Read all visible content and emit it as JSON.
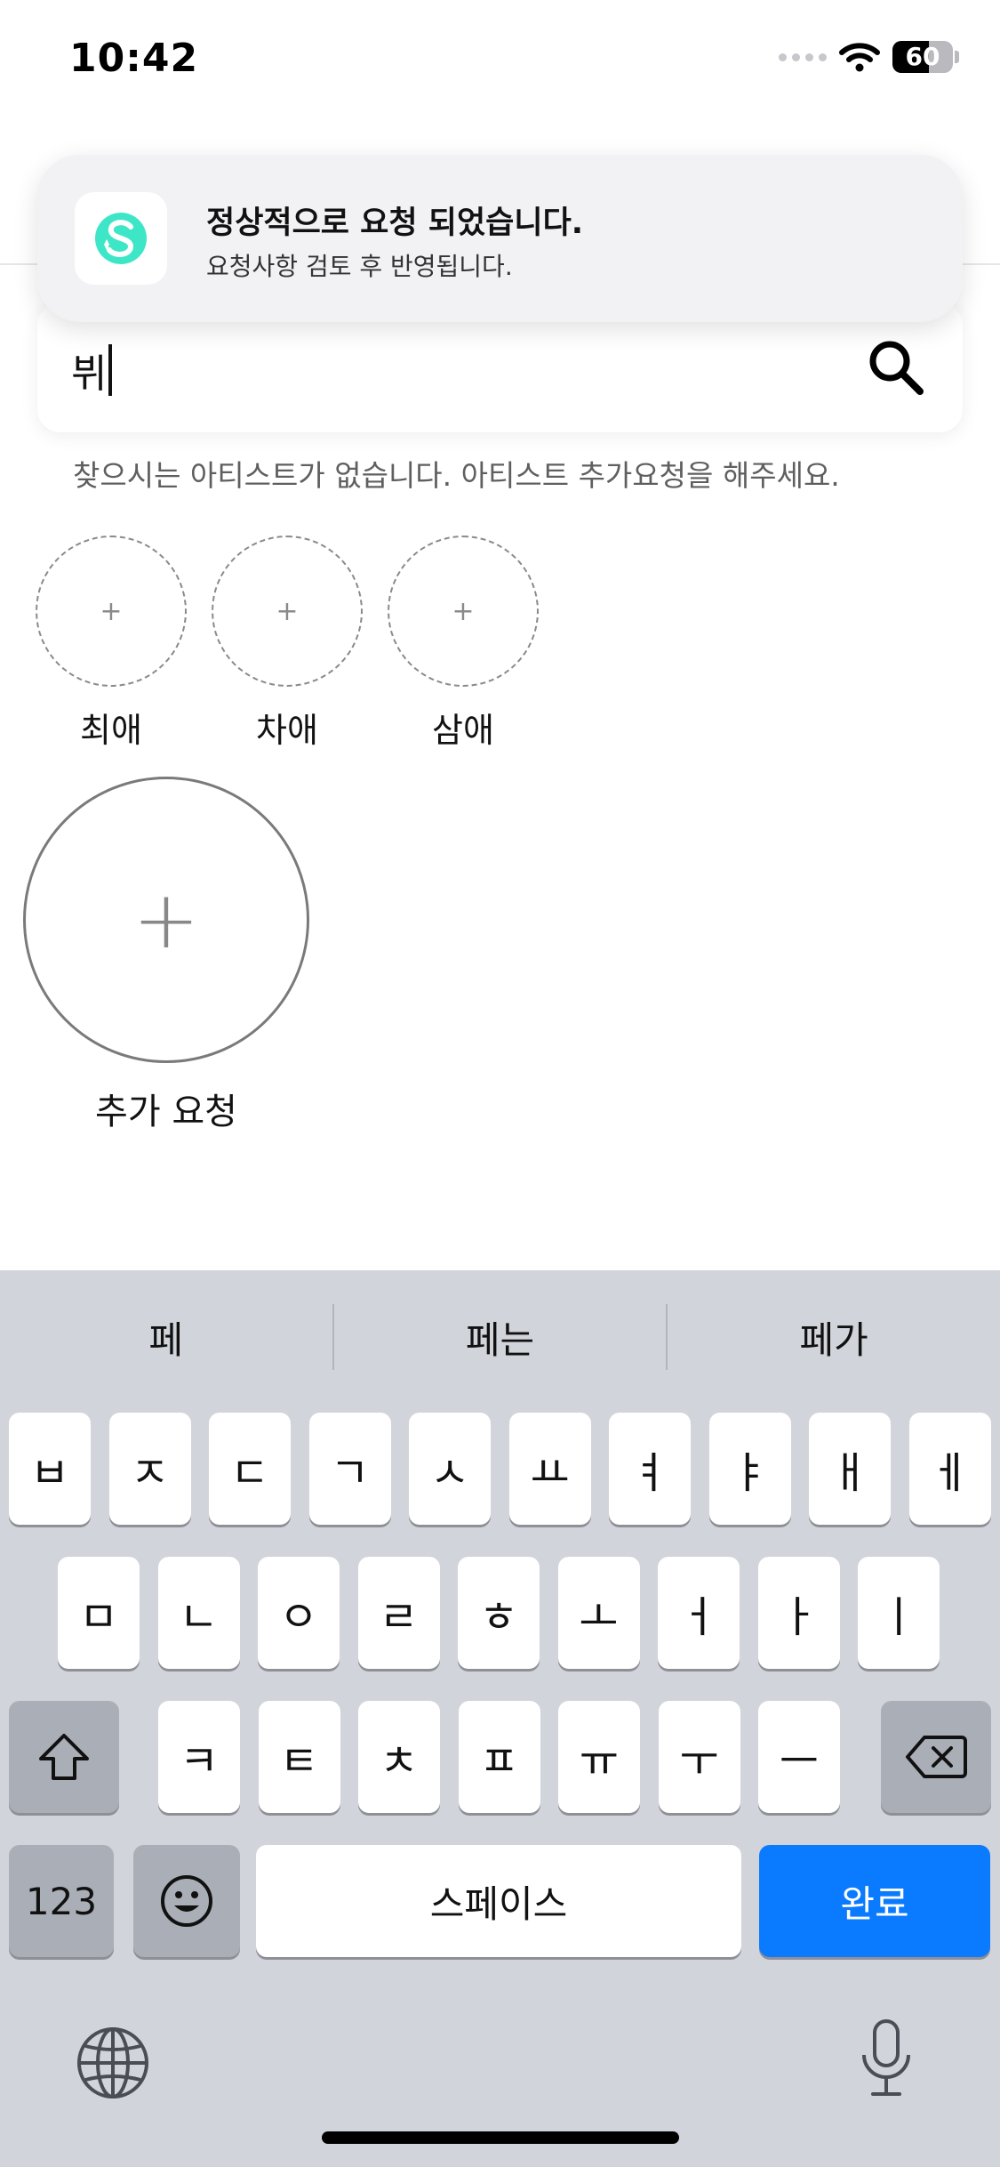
{
  "status": {
    "time": "10:42",
    "battery": "60",
    "battery_level": 0.6
  },
  "search": {
    "value": "뷔"
  },
  "no_result_message": "찾으시는 아티스트가 없습니다. 아티스트 추가요청을 해주세요.",
  "favorites": [
    {
      "plus": "+",
      "label": "최애"
    },
    {
      "plus": "+",
      "label": "차애"
    },
    {
      "plus": "+",
      "label": "삼애"
    }
  ],
  "request": {
    "plus": "+",
    "label": "추가 요청"
  },
  "toast": {
    "title": "정상적으로 요청 되었습니다.",
    "subtitle": "요청사항 검토 후 반영됩니다.",
    "logo_color": "#3ee6c8"
  },
  "keyboard": {
    "suggestions": [
      "페",
      "페는",
      "페가"
    ],
    "row1": [
      "ㅂ",
      "ㅈ",
      "ㄷ",
      "ㄱ",
      "ㅅ",
      "ㅛ",
      "ㅕ",
      "ㅑ",
      "ㅐ",
      "ㅔ"
    ],
    "row2": [
      "ㅁ",
      "ㄴ",
      "ㅇ",
      "ㄹ",
      "ㅎ",
      "ㅗ",
      "ㅓ",
      "ㅏ",
      "ㅣ"
    ],
    "row3": [
      "ㅋ",
      "ㅌ",
      "ㅊ",
      "ㅍ",
      "ㅠ",
      "ㅜ",
      "ㅡ"
    ],
    "numbers_label": "123",
    "space_label": "스페이스",
    "done_label": "완료",
    "accent_color": "#0a7aff"
  }
}
